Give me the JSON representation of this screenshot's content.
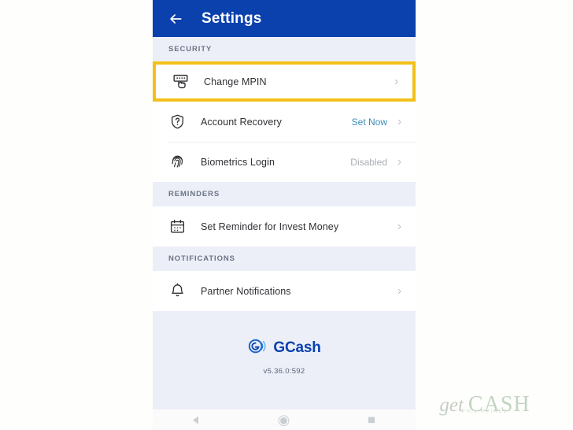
{
  "header": {
    "title": "Settings",
    "back_icon": "arrow-left-icon"
  },
  "sections": [
    {
      "label": "SECURITY",
      "rows": [
        {
          "icon": "pin-keypad-icon",
          "label": "Change MPIN",
          "value": "",
          "value_kind": "none",
          "highlighted": true
        },
        {
          "icon": "shield-question-icon",
          "label": "Account Recovery",
          "value": "Set Now",
          "value_kind": "link",
          "highlighted": false
        },
        {
          "icon": "fingerprint-icon",
          "label": "Biometrics Login",
          "value": "Disabled",
          "value_kind": "muted",
          "highlighted": false
        }
      ]
    },
    {
      "label": "REMINDERS",
      "rows": [
        {
          "icon": "calendar-icon",
          "label": "Set Reminder for Invest Money",
          "value": "",
          "value_kind": "none",
          "highlighted": false
        }
      ]
    },
    {
      "label": "NOTIFICATIONS",
      "rows": [
        {
          "icon": "bell-icon",
          "label": "Partner Notifications",
          "value": "",
          "value_kind": "none",
          "highlighted": false
        }
      ]
    }
  ],
  "brand": {
    "logo_icon": "gcash-logo-icon",
    "name": "GCash",
    "version": "v5.36.0:592"
  },
  "navbar": {
    "back": "android-back-icon",
    "home": "android-home-icon",
    "recents": "android-recents-icon"
  },
  "watermark": {
    "word1": "get",
    "word2": "CASH",
    "subtitle": "PHILIPPINES"
  },
  "colors": {
    "appbar": "#0b41ad",
    "highlight": "#f3c019",
    "section_bg": "#eceff8",
    "link": "#3d8cb8",
    "muted": "#a9adb4"
  }
}
